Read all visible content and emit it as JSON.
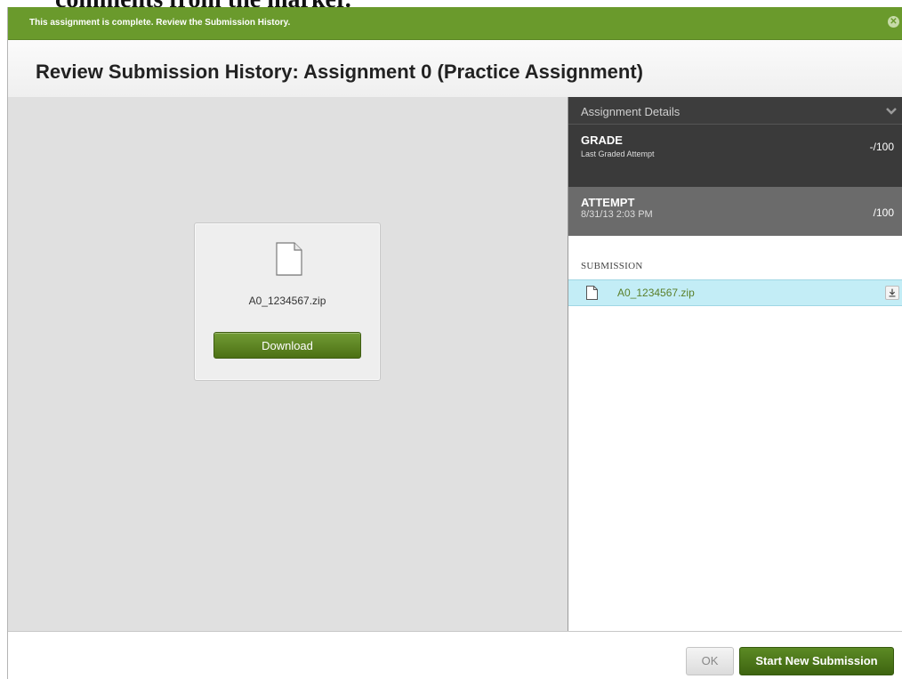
{
  "background": {
    "clipped_text": "comments from the marker."
  },
  "notice": {
    "message": "This assignment is complete. Review the Submission History.",
    "close_icon": "close-circle-icon"
  },
  "header": {
    "title": "Review Submission History: Assignment 0 (Practice Assignment)"
  },
  "preview": {
    "file_name": "A0_1234567.zip",
    "download_label": "Download",
    "file_icon": "document-icon"
  },
  "details": {
    "title": "Assignment Details",
    "toggle_icon": "chevron-down-icon",
    "grade": {
      "label": "GRADE",
      "sublabel": "Last Graded Attempt",
      "value": "-/100"
    },
    "attempt": {
      "label": "ATTEMPT",
      "date": "8/31/13 2:03 PM",
      "value": "/100"
    },
    "submission": {
      "heading": "SUBMISSION",
      "file_name": "A0_1234567.zip",
      "file_icon": "document-icon",
      "download_icon": "download-icon"
    }
  },
  "footer": {
    "ok_label": "OK",
    "new_submission_label": "Start New Submission"
  },
  "colors": {
    "notice_green": "#6a9a2c",
    "button_green": "#4c7014",
    "panel_dark": "#3a3a3a",
    "attempt_gray": "#6b6b6b",
    "selected_row": "#c3edf6",
    "link_green": "#5a7f2a"
  }
}
